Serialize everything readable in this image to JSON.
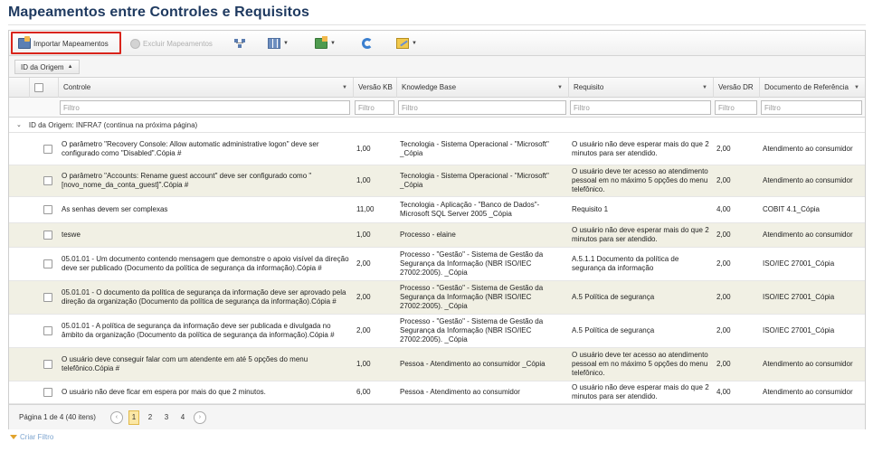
{
  "page": {
    "title": "Mapeamentos entre Controles e Requisitos"
  },
  "toolbar": {
    "import_label": "Importar Mapeamentos",
    "delete_label": "Excluir Mapeamentos"
  },
  "grouping": {
    "chip_label": "ID da Origem"
  },
  "columns": {
    "controle": "Controle",
    "versao_kb": "Versão KB",
    "knowledge_base": "Knowledge Base",
    "requisito": "Requisito",
    "versao_dr": "Versão DR",
    "documento": "Documento de Referência"
  },
  "filters": {
    "placeholder": "Filtro"
  },
  "group_row": {
    "label": "ID da Origem: INFRA7 (continua na próxima página)"
  },
  "rows": [
    {
      "controle": "O parâmetro \"Recovery Console: Allow automatic administrative logon\" deve ser configurado como \"Disabled\".Cópia #",
      "versao_kb": "1,00",
      "kb": "Tecnologia - Sistema Operacional - \"Microsoft\" _Cópia",
      "requisito": "O usuário não deve esperar mais do que 2 minutos para ser atendido.",
      "versao_dr": "2,00",
      "doc": "Atendimento ao consumidor"
    },
    {
      "controle": "O parâmetro \"Accounts: Rename guest account\" deve ser configurado como \"[novo_nome_da_conta_guest]\".Cópia #",
      "versao_kb": "1,00",
      "kb": "Tecnologia - Sistema Operacional - \"Microsoft\" _Cópia",
      "requisito": "O usuário deve ter acesso ao atendimento pessoal em no máximo 5 opções do menu telefônico.",
      "versao_dr": "2,00",
      "doc": "Atendimento ao consumidor"
    },
    {
      "controle": "As senhas devem ser complexas",
      "versao_kb": "11,00",
      "kb": "Tecnologia - Aplicação - \"Banco de Dados\"- Microsoft SQL Server 2005 _Cópia",
      "requisito": "Requisito 1",
      "versao_dr": "4,00",
      "doc": "COBIT 4.1_Cópia"
    },
    {
      "controle": "teswe",
      "versao_kb": "1,00",
      "kb": "Processo - elaine",
      "requisito": "O usuário não deve esperar mais do que 2 minutos para ser atendido.",
      "versao_dr": "2,00",
      "doc": "Atendimento ao consumidor"
    },
    {
      "controle": "05.01.01 - Um documento contendo mensagem que demonstre o apoio visível da direção deve ser publicado (Documento da política de segurança da informação).Cópia #",
      "versao_kb": "2,00",
      "kb": "Processo - \"Gestão\" - Sistema de Gestão da Segurança da Informação (NBR ISO/IEC 27002:2005). _Cópia",
      "requisito": "A.5.1.1 Documento da política de segurança da informação",
      "versao_dr": "2,00",
      "doc": "ISO/IEC 27001_Cópia"
    },
    {
      "controle": "05.01.01 - O documento da política de segurança da informação deve ser aprovado pela direção da organização (Documento da política de segurança da informação).Cópia #",
      "versao_kb": "2,00",
      "kb": "Processo - \"Gestão\" - Sistema de Gestão da Segurança da Informação (NBR ISO/IEC 27002:2005). _Cópia",
      "requisito": "A.5 Política de segurança",
      "versao_dr": "2,00",
      "doc": "ISO/IEC 27001_Cópia"
    },
    {
      "controle": "05.01.01 - A política de segurança da informação deve ser publicada e divulgada no âmbito da organização (Documento da política de segurança da informação).Cópia #",
      "versao_kb": "2,00",
      "kb": "Processo - \"Gestão\" - Sistema de Gestão da Segurança da Informação (NBR ISO/IEC 27002:2005). _Cópia",
      "requisito": "A.5 Política de segurança",
      "versao_dr": "2,00",
      "doc": "ISO/IEC 27001_Cópia"
    },
    {
      "controle": "O usuário deve conseguir falar com um atendente em até 5 opções do menu telefônico.Cópia #",
      "versao_kb": "1,00",
      "kb": "Pessoa - Atendimento ao consumidor _Cópia",
      "requisito": "O usuário deve ter acesso ao atendimento pessoal em no máximo 5 opções do menu telefônico.",
      "versao_dr": "2,00",
      "doc": "Atendimento ao consumidor"
    },
    {
      "controle": "O usuário não deve ficar em espera por mais do que 2 minutos.",
      "versao_kb": "6,00",
      "kb": "Pessoa - Atendimento ao consumidor",
      "requisito": "O usuário não deve esperar mais do que 2 minutos para ser atendido.",
      "versao_dr": "4,00",
      "doc": "Atendimento ao consumidor"
    }
  ],
  "pager": {
    "summary": "Página 1 de 4 (40 itens)",
    "pages": [
      "1",
      "2",
      "3",
      "4"
    ],
    "prev": "‹",
    "next": "›"
  },
  "footer": {
    "create_filter_label": "Criar Filtro"
  }
}
